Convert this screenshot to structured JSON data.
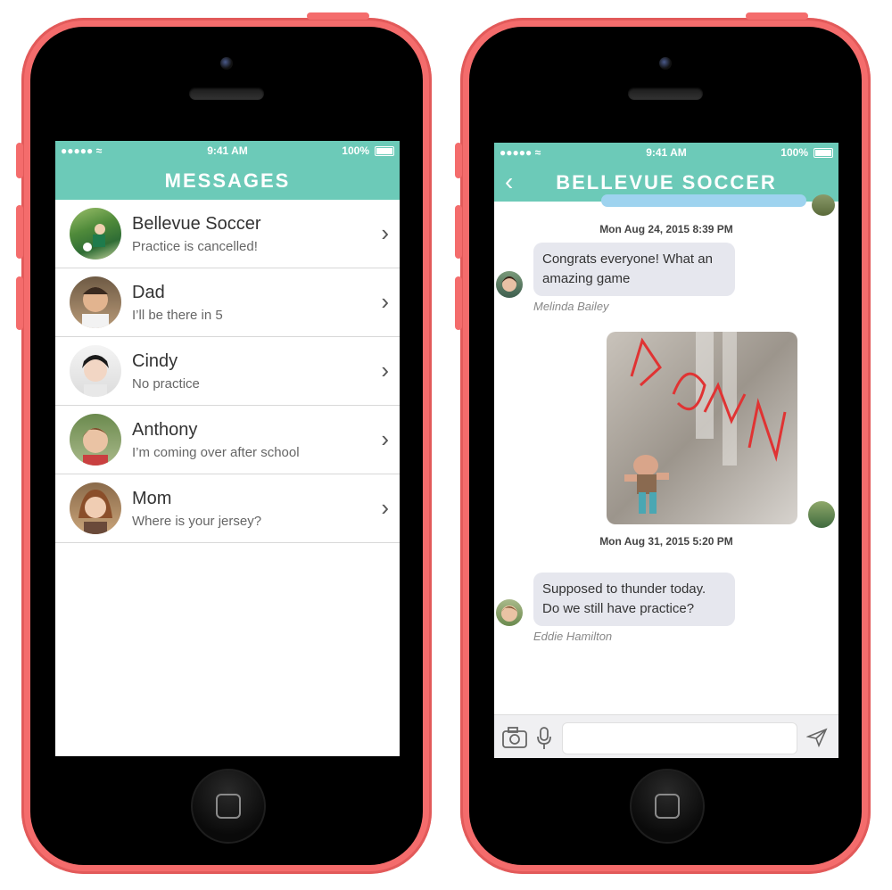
{
  "status_bar": {
    "signal": "●●●●● ≈",
    "time": "9:41 AM",
    "battery": "100%"
  },
  "messages_screen": {
    "title": "MESSAGES",
    "conversations": [
      {
        "name": "Bellevue Soccer",
        "preview": "Practice is cancelled!",
        "avatar_icon": "soccer-photo-icon"
      },
      {
        "name": "Dad",
        "preview": "I’ll be there in 5",
        "avatar_icon": "man-photo-icon"
      },
      {
        "name": "Cindy",
        "preview": "No practice",
        "avatar_icon": "girl-photo-icon"
      },
      {
        "name": "Anthony",
        "preview": "I’m coming over after school",
        "avatar_icon": "boy-photo-icon"
      },
      {
        "name": "Mom",
        "preview": "Where is your jersey?",
        "avatar_icon": "woman-photo-icon"
      }
    ]
  },
  "chat_screen": {
    "title": "BELLEVUE SOCCER",
    "timestamps": [
      "Mon Aug 24, 2015 8:39 PM",
      "Mon Aug 31, 2015 5:20 PM"
    ],
    "messages": [
      {
        "text_line1": "Congrats everyone! What an",
        "text_line2": "amazing game",
        "sender": "Melinda Bailey"
      },
      {
        "text_line1": "Supposed to thunder today.",
        "text_line2": "Do we still have practice?",
        "sender": "Eddie Hamilton"
      }
    ],
    "photo_overlay_text": "POW!"
  },
  "colors": {
    "phone": "#f46c6c",
    "header": "#6ccab8",
    "bubble": "#e6e7ee"
  }
}
